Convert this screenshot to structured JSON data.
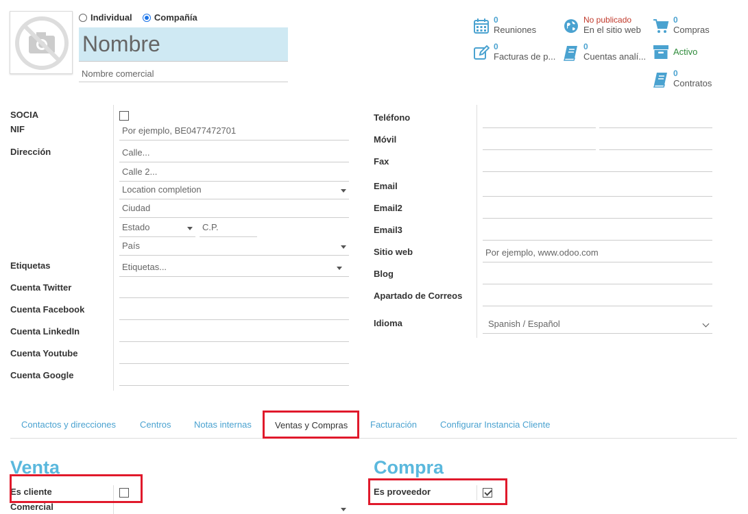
{
  "type_select": {
    "individual": "Individual",
    "company": "Compañía"
  },
  "name_placeholder": "Nombre",
  "trade_name_placeholder": "Nombre comercial",
  "smart_buttons": {
    "meetings": {
      "count": "0",
      "label": "Reuniones"
    },
    "website": {
      "status": "No publicado",
      "label": "En el sitio web"
    },
    "purchases": {
      "count": "0",
      "label": "Compras"
    },
    "invoices": {
      "count": "0",
      "label": "Facturas de p..."
    },
    "analytic": {
      "count": "0",
      "label": "Cuentas analí..."
    },
    "active": {
      "label": "Activo"
    },
    "contracts": {
      "count": "0",
      "label": "Contratos"
    }
  },
  "left_labels": {
    "socia": "SOCIA",
    "nif": "NIF",
    "address": "Dirección",
    "tags": "Etiquetas",
    "twitter": "Cuenta Twitter",
    "facebook": "Cuenta Facebook",
    "linkedin": "Cuenta LinkedIn",
    "youtube": "Cuenta Youtube",
    "google": "Cuenta Google"
  },
  "left_fields": {
    "nif_placeholder": "Por ejemplo, BE0477472701",
    "street": "Calle...",
    "street2": "Calle 2...",
    "location": "Location completion",
    "city": "Ciudad",
    "state": "Estado",
    "zip": "C.P.",
    "country": "País",
    "tags": "Etiquetas..."
  },
  "right_labels": {
    "phone": "Teléfono",
    "mobile": "Móvil",
    "fax": "Fax",
    "email": "Email",
    "email2": "Email2",
    "email3": "Email3",
    "website": "Sitio web",
    "blog": "Blog",
    "po_box": "Apartado de Correos",
    "language": "Idioma"
  },
  "right_fields": {
    "website_placeholder": "Por ejemplo, www.odoo.com",
    "language": "Spanish / Español"
  },
  "tabs": [
    "Contactos y direcciones",
    "Centros",
    "Notas internas",
    "Ventas y Compras",
    "Facturación",
    "Configurar Instancia Cliente"
  ],
  "sales": {
    "title": "Venta",
    "is_customer": "Es cliente",
    "salesperson": "Comercial"
  },
  "purchase": {
    "title": "Compra",
    "is_supplier": "Es proveedor"
  },
  "colors": {
    "accent": "#4aa2d0",
    "highlight": "#e0192b",
    "name_bg": "#cfe9f3"
  }
}
